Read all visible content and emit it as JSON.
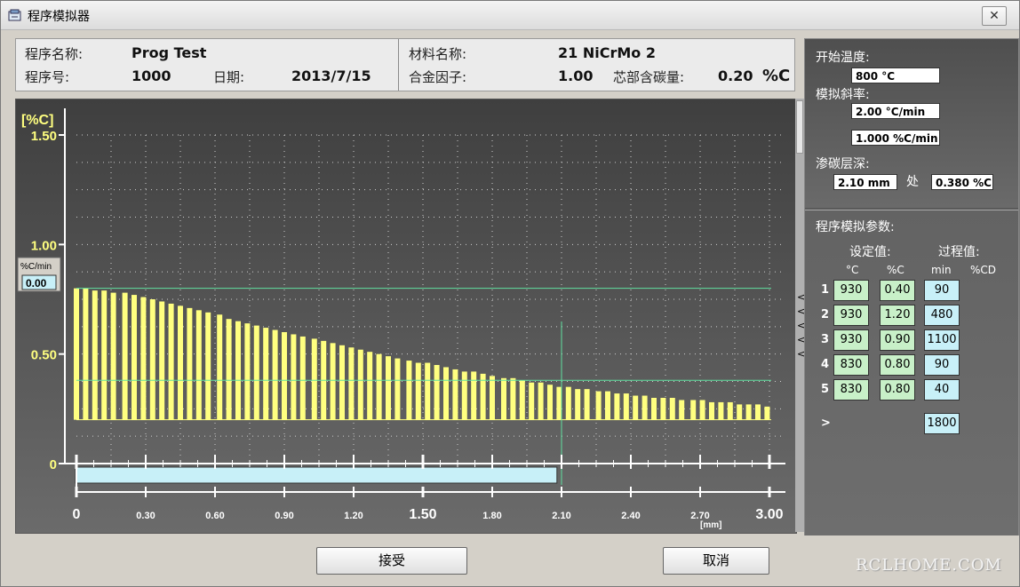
{
  "window": {
    "title": "程序模拟器",
    "close_label": "✕"
  },
  "header": {
    "program_name_label": "程序名称:",
    "program_name": "Prog Test",
    "program_no_label": "程序号:",
    "program_no": "1000",
    "date_label": "日期:",
    "date": "2013/7/15",
    "material_label": "材料名称:",
    "material": "21 NiCrMo 2",
    "alloy_label": "合金因子:",
    "alloy": "1.00",
    "core_carbon_label": "芯部含碳量:",
    "core_carbon": "0.20",
    "core_carbon_unit": "%C"
  },
  "chart_data": {
    "type": "bar",
    "title": "",
    "ylabel": "[%C]",
    "xlabel": "[mm]",
    "ylim": [
      0,
      1.5
    ],
    "xlim": [
      0,
      3.0
    ],
    "y_ticks": [
      "1.50",
      "1.00",
      "0.50",
      "0"
    ],
    "x_ticks": [
      "0",
      "0.30",
      "0.60",
      "0.90",
      "1.20",
      "1.50",
      "1.80",
      "2.10",
      "2.40",
      "2.70",
      "3.00"
    ],
    "x": [
      0.0,
      0.04,
      0.08,
      0.12,
      0.16,
      0.21,
      0.25,
      0.29,
      0.33,
      0.37,
      0.41,
      0.45,
      0.49,
      0.53,
      0.57,
      0.62,
      0.66,
      0.7,
      0.74,
      0.78,
      0.82,
      0.86,
      0.9,
      0.94,
      0.98,
      1.03,
      1.07,
      1.11,
      1.15,
      1.19,
      1.23,
      1.27,
      1.31,
      1.35,
      1.39,
      1.44,
      1.48,
      1.52,
      1.56,
      1.6,
      1.64,
      1.68,
      1.72,
      1.76,
      1.8,
      1.85,
      1.89,
      1.93,
      1.97,
      2.01,
      2.05,
      2.09,
      2.13,
      2.17,
      2.21,
      2.26,
      2.3,
      2.34,
      2.38,
      2.42,
      2.46,
      2.5,
      2.54,
      2.58,
      2.62,
      2.67,
      2.71,
      2.75,
      2.79,
      2.83,
      2.87,
      2.91,
      2.95,
      2.99
    ],
    "values": [
      0.8,
      0.8,
      0.79,
      0.79,
      0.78,
      0.78,
      0.77,
      0.76,
      0.75,
      0.74,
      0.73,
      0.72,
      0.71,
      0.7,
      0.69,
      0.68,
      0.66,
      0.65,
      0.64,
      0.63,
      0.62,
      0.61,
      0.6,
      0.59,
      0.58,
      0.57,
      0.56,
      0.55,
      0.54,
      0.53,
      0.52,
      0.51,
      0.5,
      0.49,
      0.48,
      0.47,
      0.46,
      0.46,
      0.45,
      0.44,
      0.43,
      0.42,
      0.42,
      0.41,
      0.4,
      0.39,
      0.39,
      0.38,
      0.37,
      0.37,
      0.36,
      0.35,
      0.35,
      0.34,
      0.34,
      0.33,
      0.33,
      0.32,
      0.32,
      0.31,
      0.31,
      0.3,
      0.3,
      0.3,
      0.29,
      0.29,
      0.29,
      0.28,
      0.28,
      0.28,
      0.27,
      0.27,
      0.27,
      0.26
    ],
    "reference_lines_y": [
      0.8,
      0.38,
      0.2
    ],
    "marker_x": 2.1,
    "progress_end_x": 2.08,
    "grid": true,
    "rate_label": "%C/min",
    "rate_value": "0.00"
  },
  "side": {
    "start_temp_label": "开始温度:",
    "start_temp": "800 °C",
    "ramp_label": "模拟斜率:",
    "ramp_temp": "2.00 °C/min",
    "ramp_carbon": "1.000 %C/min",
    "depth_label": "渗碳层深:",
    "depth": "2.10 mm",
    "at_label": "处",
    "depth_carbon": "0.380 %C",
    "params_label": "程序模拟参数:",
    "setpoint_label": "设定值:",
    "process_label": "过程值:",
    "col_headers": [
      "°C",
      "%C",
      "min",
      "%CD"
    ],
    "rows": [
      {
        "no": "1",
        "temp": "930",
        "carbon": "0.40",
        "time": "90"
      },
      {
        "no": "2",
        "temp": "930",
        "carbon": "1.20",
        "time": "480"
      },
      {
        "no": "3",
        "temp": "930",
        "carbon": "0.90",
        "time": "1100"
      },
      {
        "no": "4",
        "temp": "830",
        "carbon": "0.80",
        "time": "90"
      },
      {
        "no": "5",
        "temp": "830",
        "carbon": "0.80",
        "time": "40"
      }
    ],
    "total_marker": ">",
    "total_time": "1800"
  },
  "buttons": {
    "accept": "接受",
    "cancel": "取消"
  },
  "watermark": "RCLHOME.COM",
  "arrow_glyph": "<"
}
